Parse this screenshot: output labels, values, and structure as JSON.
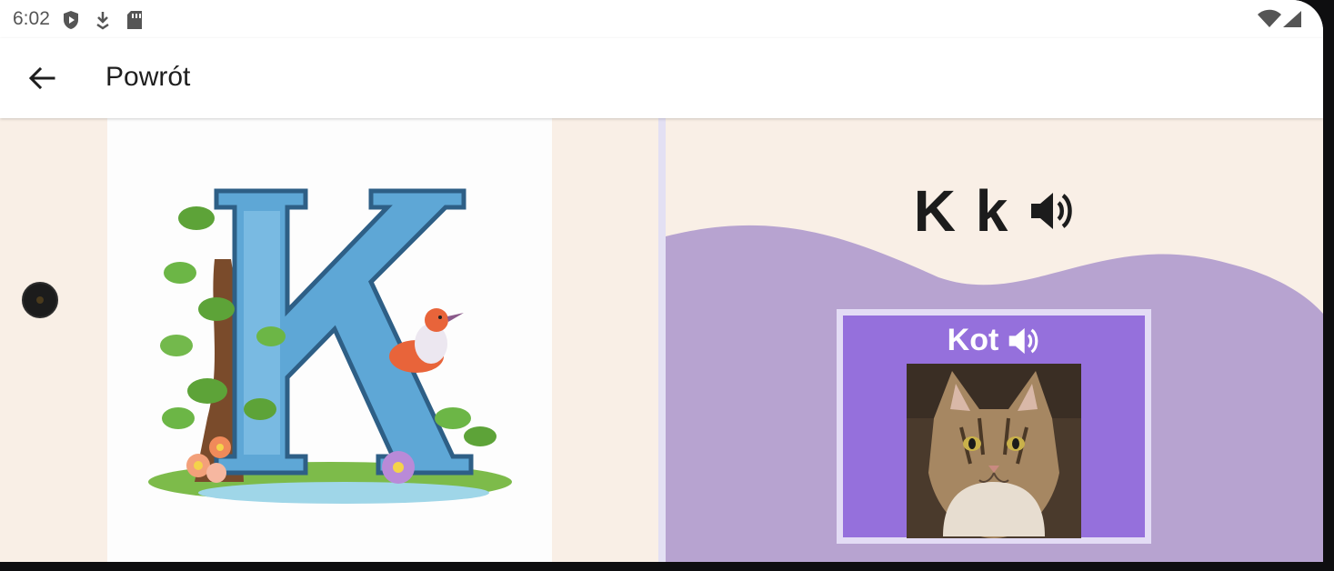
{
  "status_bar": {
    "time": "6:02",
    "left_icons": [
      "shield-play-icon",
      "download-icon",
      "sd-card-icon"
    ],
    "right_icons": [
      "wifi-icon",
      "signal-icon"
    ]
  },
  "app_bar": {
    "back_icon": "arrow-back-icon",
    "title": "Powrót"
  },
  "letter": {
    "text": "K k",
    "speaker_icon": "volume-icon",
    "image": "letter-k-illustration"
  },
  "word": {
    "text": "Kot",
    "speaker_icon": "volume-icon",
    "image": "cat-photo"
  },
  "colors": {
    "background": "#f9efe6",
    "wave": "#b7a3d0",
    "card": "#9570dc",
    "card_border": "#e3dcf5",
    "divider": "#e3e0f3"
  }
}
